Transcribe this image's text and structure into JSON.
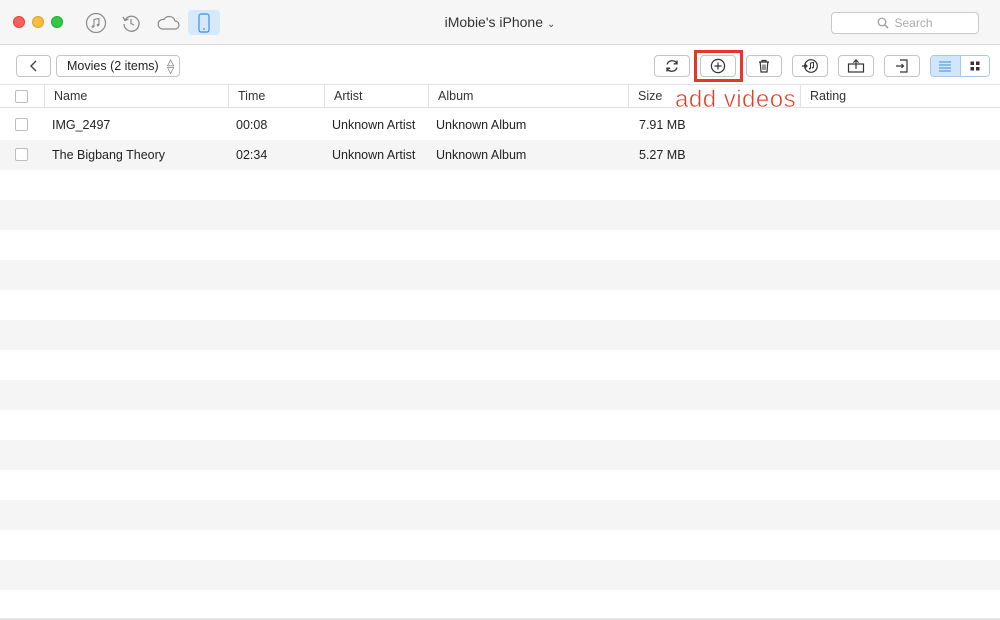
{
  "window": {
    "device_title": "iMobie's iPhone",
    "search_placeholder": "Search"
  },
  "nav": {
    "icons": [
      "music-icon",
      "backup-restore-icon",
      "icloud-icon",
      "iphone-icon"
    ],
    "active": "iphone-icon"
  },
  "toolbar": {
    "category": "Movies (2 items)",
    "actions": [
      "refresh-icon",
      "add-icon",
      "delete-icon",
      "send-to-itunes-icon",
      "send-to-device-icon",
      "send-to-computer-icon"
    ],
    "view_modes": [
      "list-view-icon",
      "grid-view-icon"
    ],
    "active_view": "list-view-icon"
  },
  "annotation": {
    "text": "add videos",
    "color": "#e83a22"
  },
  "table": {
    "columns": [
      "Name",
      "Time",
      "Artist",
      "Album",
      "Size",
      "Rating"
    ],
    "rows": [
      {
        "name": "IMG_2497",
        "time": "00:08",
        "artist": "Unknown Artist",
        "album": "Unknown Album",
        "size": "7.91 MB",
        "rating": ""
      },
      {
        "name": "The Bigbang Theory",
        "time": "02:34",
        "artist": "Unknown Artist",
        "album": "Unknown Album",
        "size": "5.27 MB",
        "rating": ""
      }
    ]
  },
  "colors": {
    "accent": "#cfe6fb",
    "highlight": "#e8352b",
    "row_alt": "#f5f5f5"
  }
}
